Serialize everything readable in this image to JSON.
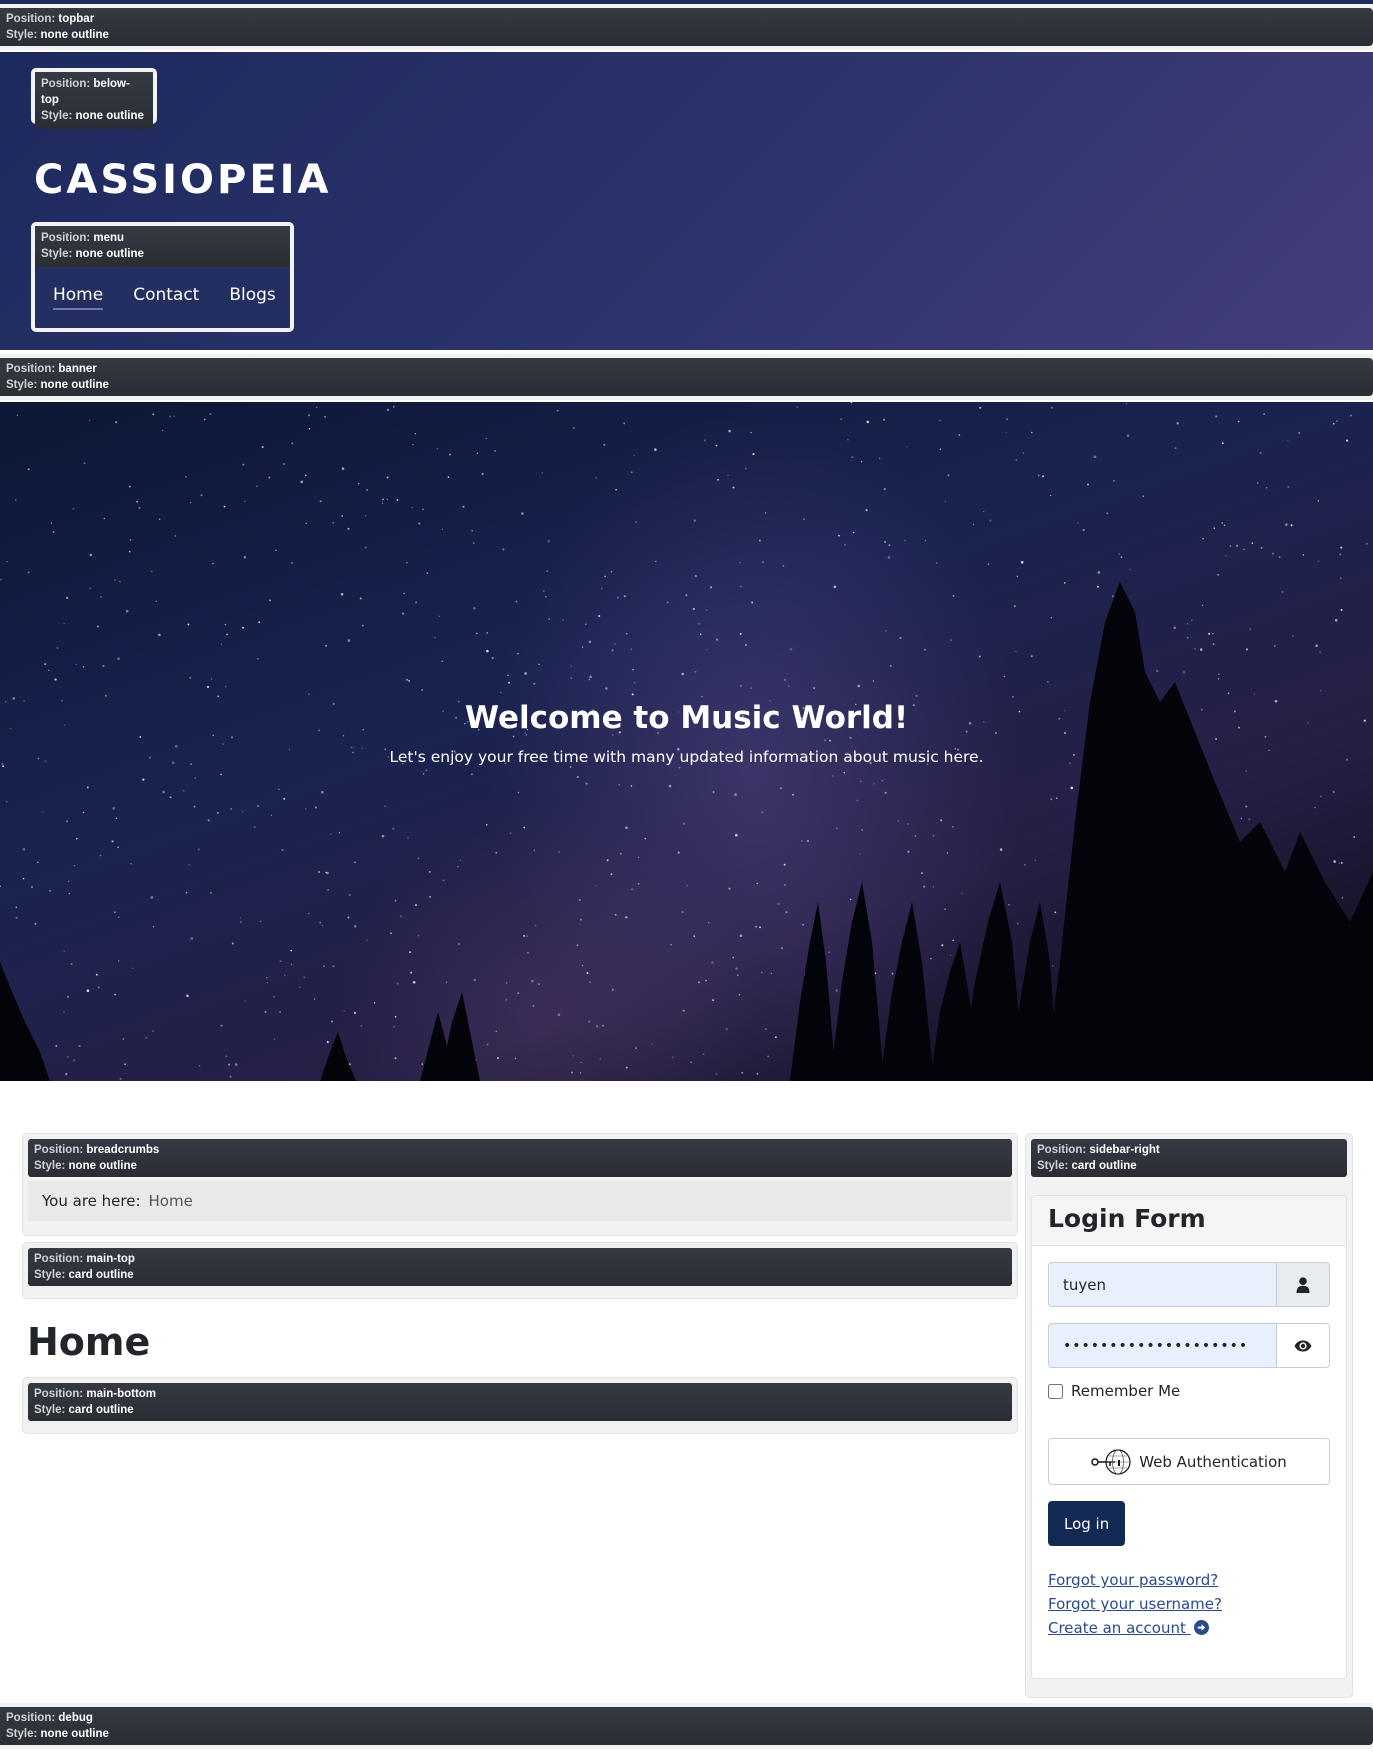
{
  "positions": {
    "topbar": {
      "position": "topbar",
      "style": "none outline"
    },
    "below_top": {
      "position": "below-top",
      "style": "none outline"
    },
    "menu": {
      "position": "menu",
      "style": "none outline"
    },
    "banner": {
      "position": "banner",
      "style": "none outline"
    },
    "breadcrumbs": {
      "position": "breadcrumbs",
      "style": "none outline"
    },
    "main_top": {
      "position": "main-top",
      "style": "card outline"
    },
    "main_bottom": {
      "position": "main-bottom",
      "style": "card outline"
    },
    "sidebar_right": {
      "position": "sidebar-right",
      "style": "card outline"
    },
    "debug": {
      "position": "debug",
      "style": "none outline"
    }
  },
  "labels": {
    "position_key": "Position:",
    "style_key": "Style:"
  },
  "header": {
    "brand": "CASSIOPEIA",
    "menu": [
      {
        "label": "Home",
        "active": true
      },
      {
        "label": "Contact",
        "active": false
      },
      {
        "label": "Blogs",
        "active": false
      }
    ]
  },
  "hero": {
    "title": "Welcome to Music World!",
    "subtitle": "Let's enjoy your free time with many updated information about music here."
  },
  "breadcrumbs": {
    "prefix": "You are here:",
    "current": "Home"
  },
  "main": {
    "page_title": "Home"
  },
  "login": {
    "title": "Login Form",
    "username_value": "tuyen",
    "password_value": "••••••••••••••••••••",
    "username_icon": "user-icon",
    "password_icon": "eye-icon",
    "remember_label": "Remember Me",
    "remember_checked": false,
    "webauthn_label": "Web Authentication",
    "login_button": "Log in",
    "links": {
      "forgot_password": "Forgot your password?",
      "forgot_username": "Forgot your username?",
      "create_account": "Create an account"
    }
  },
  "colors": {
    "header_start": "#1d2a5e",
    "header_end": "#443e7a",
    "login_button": "#132a54",
    "link": "#2a4a8c",
    "input_bg": "#e8f0fe"
  }
}
